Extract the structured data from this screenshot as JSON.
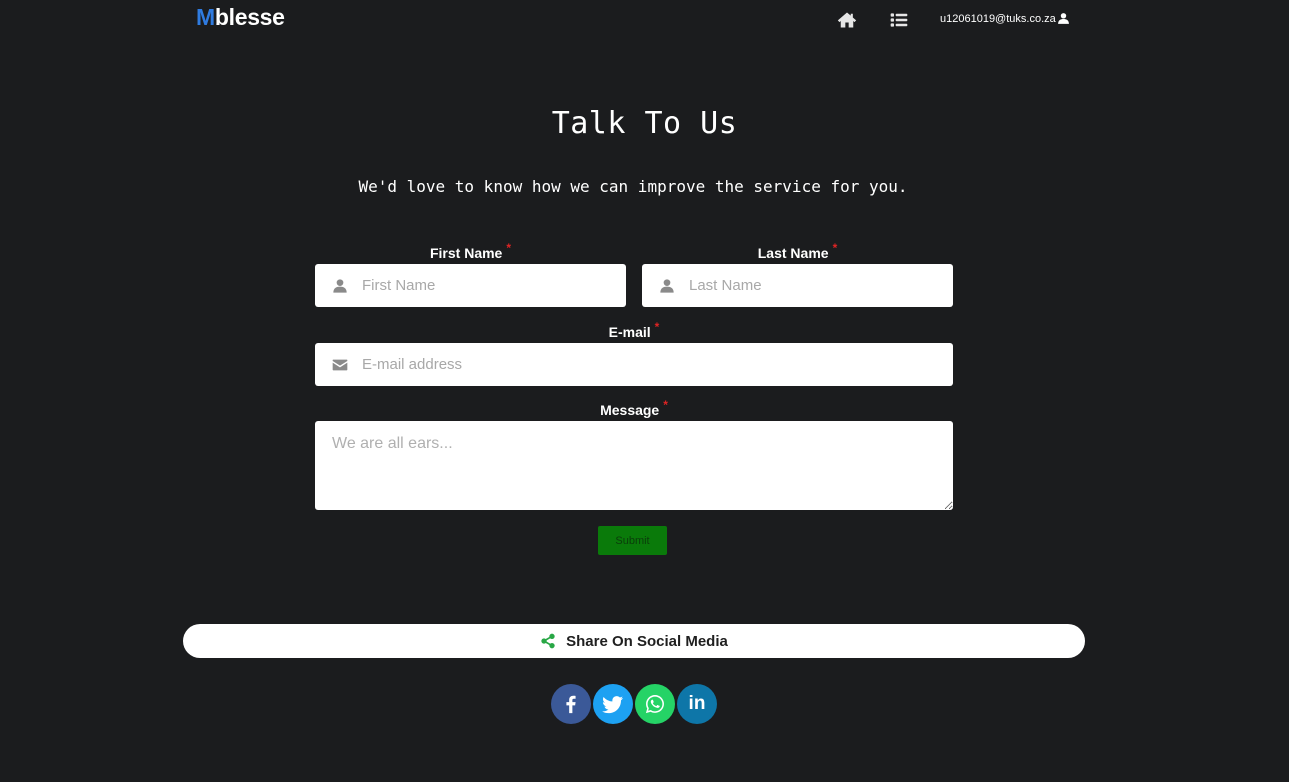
{
  "nav": {
    "logo_first": "M",
    "logo_rest": "blesse",
    "user_email": "u12061019@tuks.co.za",
    "icons": [
      "home-icon",
      "list-icon",
      "user-icon"
    ]
  },
  "hero": {
    "title": "Talk To Us",
    "subtitle": "We'd love to know how we can improve the service for you."
  },
  "form": {
    "required_mark": "*",
    "first_name": {
      "label": "First Name",
      "placeholder": "First Name",
      "value": ""
    },
    "last_name": {
      "label": "Last Name",
      "placeholder": "Last Name",
      "value": ""
    },
    "email": {
      "label": "E-mail",
      "placeholder": "E-mail address",
      "value": ""
    },
    "message": {
      "label": "Message",
      "placeholder": "We are all ears...",
      "value": ""
    },
    "submit_label": "Submit"
  },
  "share": {
    "label": "Share On Social Media",
    "networks": [
      "facebook",
      "twitter",
      "whatsapp",
      "linkedin"
    ],
    "linkedin_text": "in"
  },
  "colors": {
    "background": "#1b1c1e",
    "logo_accent": "#2f7be0",
    "submit_bg": "#0a7a0a",
    "required": "#e02424",
    "share_icon": "#28a745"
  }
}
